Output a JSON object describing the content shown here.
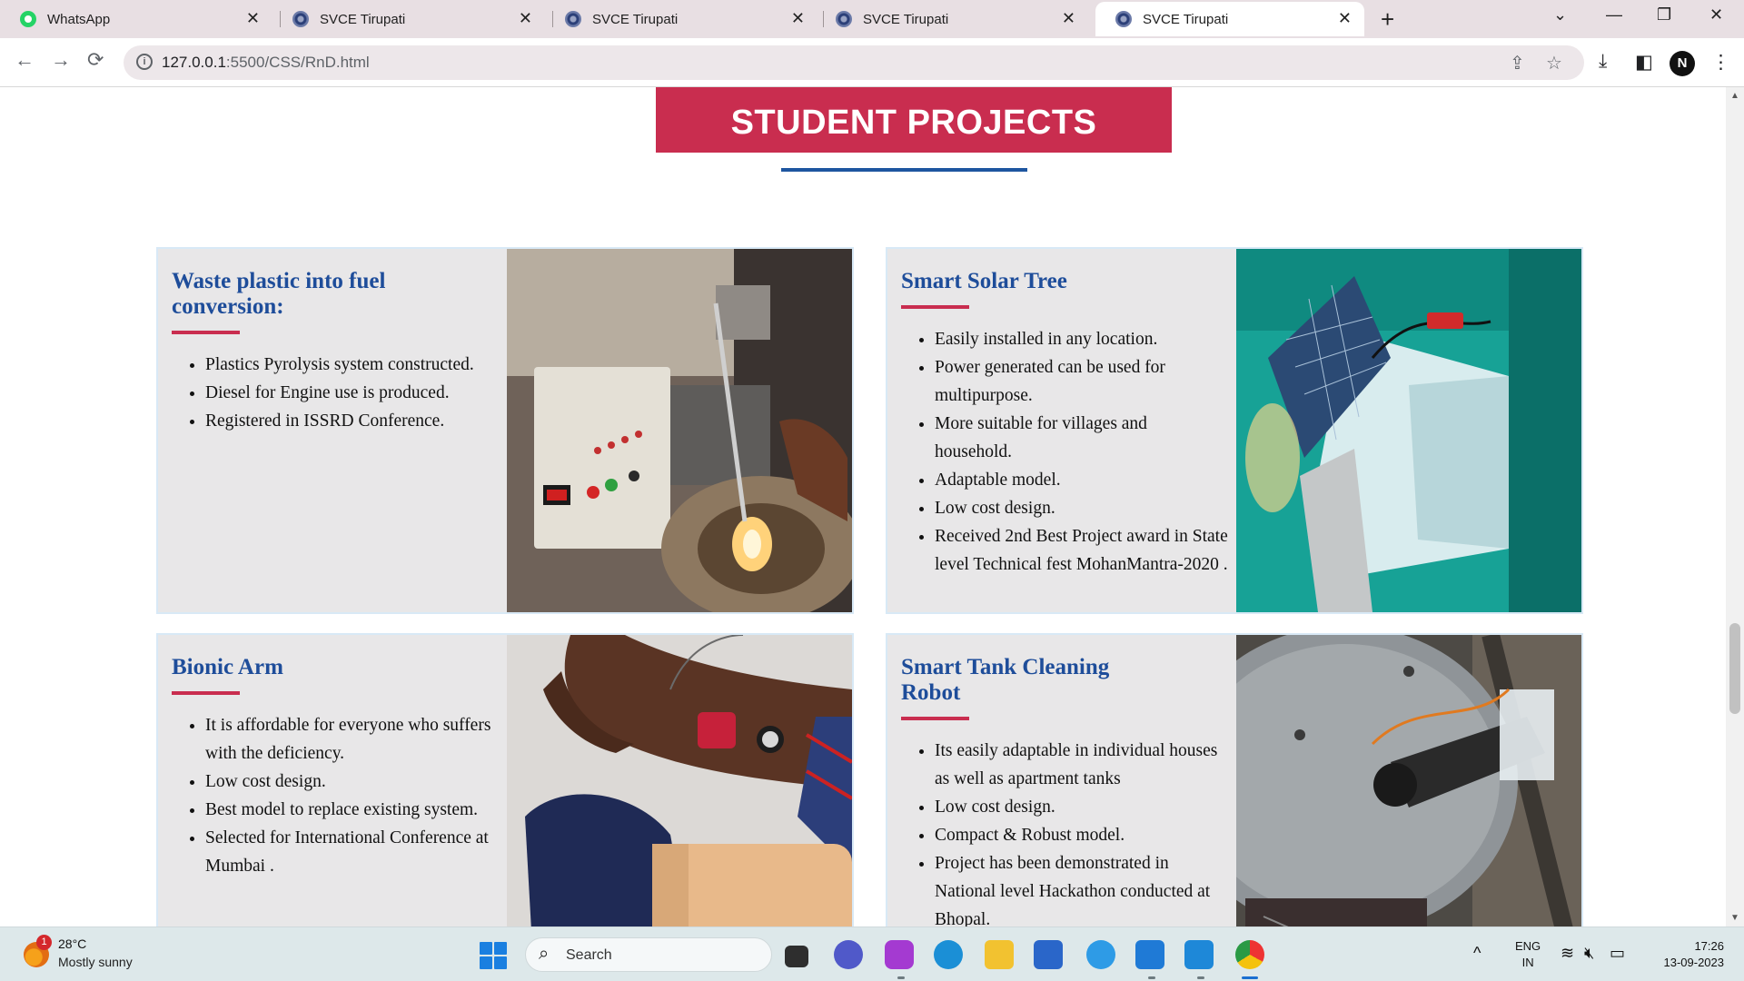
{
  "browser": {
    "tabs": [
      {
        "title": "WhatsApp",
        "icon": "whatsapp-icon",
        "active": false
      },
      {
        "title": "SVCE Tirupati",
        "icon": "svce-favicon",
        "active": false
      },
      {
        "title": "SVCE Tirupati",
        "icon": "svce-favicon",
        "active": false
      },
      {
        "title": "SVCE Tirupati",
        "icon": "svce-favicon",
        "active": false
      },
      {
        "title": "SVCE Tirupati",
        "icon": "svce-favicon",
        "active": true
      }
    ],
    "url_host": "127.0.0.1",
    "url_path": ":5500/CSS/RnD.html",
    "profile_initial": "N"
  },
  "page": {
    "section_title": "STUDENT PROJECTS",
    "accent_color": "#c92d4f",
    "title_color": "#1e4d9a",
    "projects": [
      {
        "title": "Waste plastic into fuel conversion:",
        "points": [
          "Plastics Pyrolysis system constructed.",
          "Diesel for Engine use is produced.",
          "Registered in ISSRD Conference."
        ]
      },
      {
        "title": "Smart Solar Tree",
        "points": [
          "Easily installed in any location.",
          "Power generated can be used for multipurpose.",
          "More suitable for villages and household.",
          "Adaptable model.",
          "Low cost design.",
          "Received 2nd Best Project award in State level Technical fest MohanMantra-2020 ."
        ]
      },
      {
        "title": "Bionic Arm",
        "points": [
          "It is affordable for everyone who suffers with the deficiency.",
          "Low cost design.",
          "Best model to replace existing system.",
          "Selected for International Conference at Mumbai ."
        ]
      },
      {
        "title": "Smart Tank Cleaning Robot",
        "points": [
          "Its easily adaptable in individual houses as well as apartment tanks",
          "Low cost design.",
          "Compact & Robust model.",
          "Project has been demonstrated in National level Hackathon conducted at Bhopal."
        ]
      }
    ]
  },
  "taskbar": {
    "weather_temp": "28°C",
    "weather_desc": "Mostly sunny",
    "notification_count": "1",
    "search_label": "Search",
    "lang_top": "ENG",
    "lang_bottom": "IN",
    "time": "17:26",
    "date": "13-09-2023"
  }
}
